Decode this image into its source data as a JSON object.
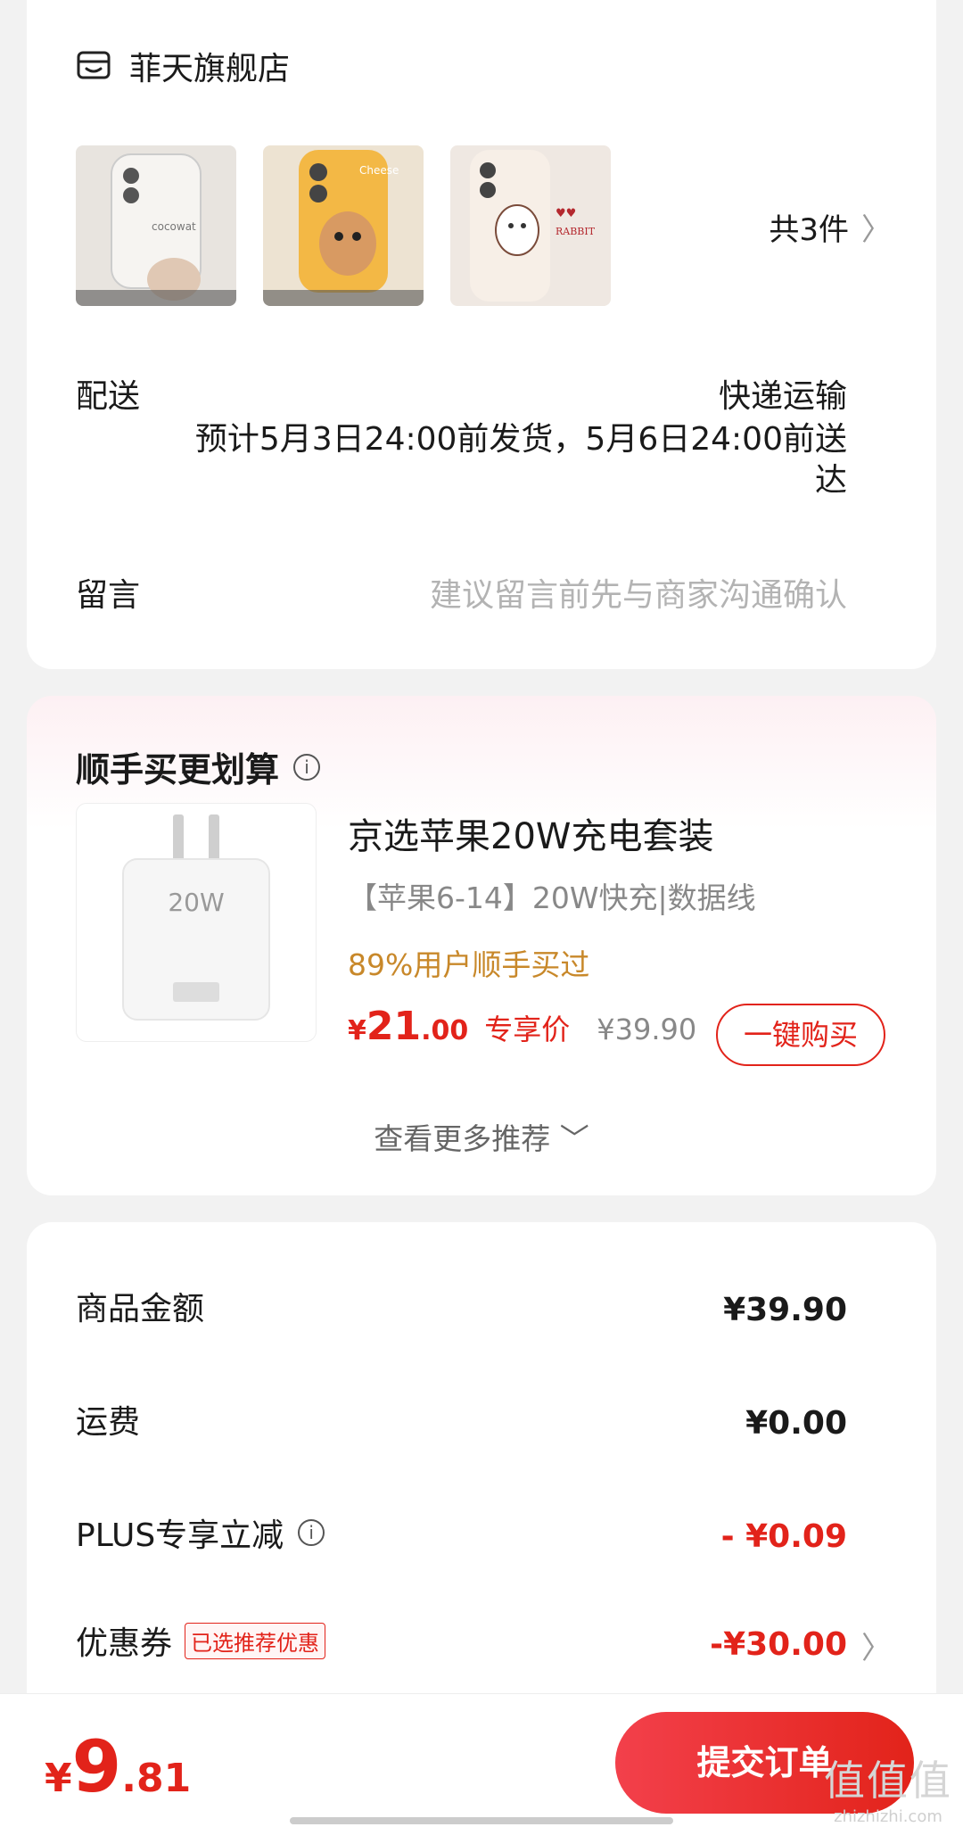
{
  "store": {
    "name": "菲天旗舰店",
    "item_count": "共3件",
    "thumbnails": [
      {
        "caption": "cocowat"
      },
      {
        "caption": "Cheese"
      },
      {
        "caption": "RABBIT"
      }
    ]
  },
  "delivery": {
    "label": "配送",
    "method": "快递运输",
    "eta": "预计5月3日24:00前发货，5月6日24:00前送达"
  },
  "note": {
    "label": "留言",
    "placeholder": "建议留言前先与商家沟通确认"
  },
  "recommend": {
    "title": "顺手买更划算",
    "product_name": "京选苹果20W充电套装",
    "spec": "【苹果6-14】20W快充|数据线",
    "popularity": "89%用户顺手买过",
    "price_currency": "¥",
    "price_int": "21",
    "price_dec": ".00",
    "price_tag": "专享价",
    "original_price": "¥39.90",
    "buy_label": "一键购买",
    "more_label": "查看更多推荐"
  },
  "summary": {
    "goods_label": "商品金额",
    "goods_value": "¥39.90",
    "shipping_label": "运费",
    "shipping_value": "¥0.00",
    "plus_label": "PLUS专享立减",
    "plus_value": "- ¥0.09",
    "coupon_label": "优惠券",
    "coupon_badge": "已选推荐优惠",
    "coupon_value": "-¥30.00"
  },
  "footer": {
    "total_currency": "¥",
    "total_int": "9",
    "total_dec": ".81",
    "submit_label": "提交订单"
  },
  "watermark": {
    "main": "值值值",
    "sub": "zhizhizhi.com"
  },
  "colors": {
    "accent": "#e2231a",
    "popularity": "#c8882a",
    "background": "#f2f2f2"
  }
}
